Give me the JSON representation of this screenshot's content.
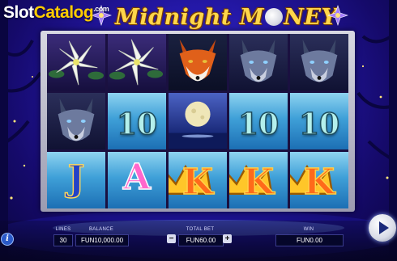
{
  "watermark": {
    "slot": "Slot",
    "catalog": "Catalog",
    "com": ".com"
  },
  "logo": {
    "part1": "Midnight M",
    "part2": "NEY"
  },
  "reels": [
    [
      "lily",
      "wolf",
      "J"
    ],
    [
      "lily",
      "10",
      "A"
    ],
    [
      "fox",
      "moon",
      "K"
    ],
    [
      "wolf",
      "10",
      "K"
    ],
    [
      "wolf",
      "10",
      "K"
    ]
  ],
  "symbols": {
    "ten": "10",
    "jack": "J",
    "ace": "A",
    "king": "K"
  },
  "controls": {
    "info_label": "i",
    "lines_label": "LINES",
    "lines_value": "30",
    "balance_label": "BALANCE",
    "balance_value": "FUN10,000.00",
    "total_bet_label": "TOTAL BET",
    "total_bet_value": "FUN60.00",
    "minus_label": "−",
    "plus_label": "+",
    "win_label": "WIN",
    "win_value": "FUN0.00"
  },
  "colors": {
    "sky": "#2418a8",
    "gold": "#ffd64a",
    "reel_blue": "#3fa0d8",
    "panel_dark": "#05062a"
  }
}
